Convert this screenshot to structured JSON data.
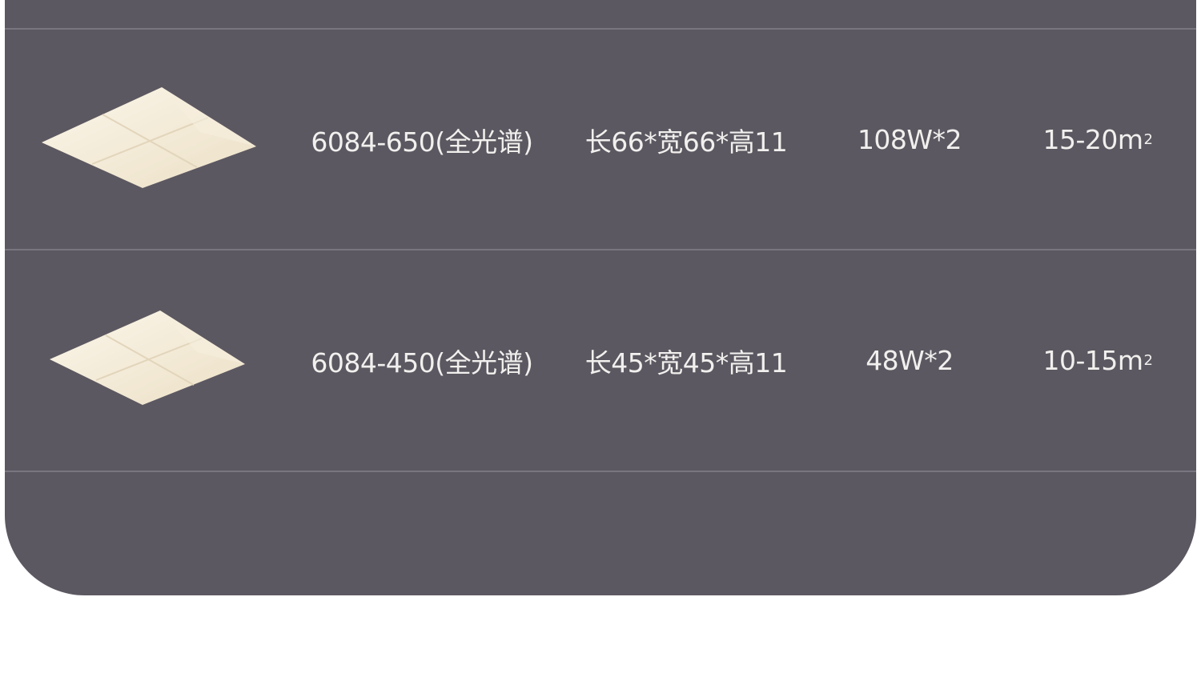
{
  "table": {
    "rows": [
      {
        "image_icon": "square-ceiling-lamp-icon",
        "model": "6084-650(全光谱)",
        "size": "长66*宽66*高11",
        "power": "108W*2",
        "area": "15-20m",
        "area_sup": "2"
      },
      {
        "image_icon": "square-ceiling-lamp-icon",
        "model": "6084-450(全光谱)",
        "size": "长45*宽45*高11",
        "power": "48W*2",
        "area": "10-15m",
        "area_sup": "2"
      }
    ]
  },
  "colors": {
    "panel_bg": "#5c5861",
    "divider": "#7a7680",
    "text": "#f2f0ee",
    "lamp": "#f3ead8"
  }
}
